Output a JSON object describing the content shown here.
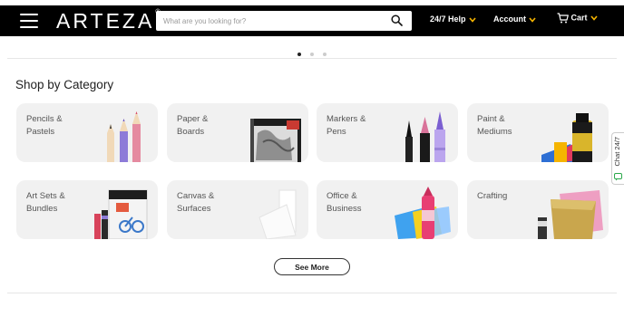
{
  "header": {
    "logo": "ARTEZA",
    "logo_mark": "®",
    "search_placeholder": "What are you looking for?",
    "help_label": "24/7 Help",
    "account_label": "Account",
    "cart_label": "Cart",
    "chevron_color": "#f5b400"
  },
  "carousel": {
    "dot_count": 3,
    "active_index": 0
  },
  "section": {
    "title": "Shop by Category"
  },
  "categories": [
    {
      "label": "Pencils &\nPastels",
      "icon": "colored-pencils"
    },
    {
      "label": "Paper &\nBoards",
      "icon": "sketchbook"
    },
    {
      "label": "Markers &\nPens",
      "icon": "markers"
    },
    {
      "label": "Paint &\nMediums",
      "icon": "paint-tube"
    },
    {
      "label": "Art Sets &\nBundles",
      "icon": "art-set"
    },
    {
      "label": "Canvas &\nSurfaces",
      "icon": "canvas-panels"
    },
    {
      "label": "Office &\nBusiness",
      "icon": "highlighter-notes"
    },
    {
      "label": "Crafting",
      "icon": "crafting-paper"
    }
  ],
  "actions": {
    "see_more": "See More"
  },
  "chat": {
    "label": "Chat 24/7"
  }
}
